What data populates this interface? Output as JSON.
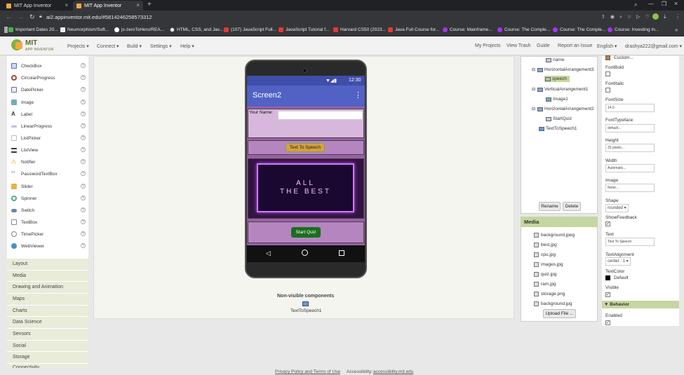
{
  "browser": {
    "tabs": [
      {
        "label": "MIT App Inventor"
      },
      {
        "label": "MIT App Inventor"
      }
    ],
    "url": "ai2.appinventor.mit.edu/#5814246258573312",
    "bookmarks": [
      "Important Dates 20...",
      "Neumorphism/Soft...",
      "js-zeroToHero/REA...",
      "HTML, CSS, and Jav...",
      "(107) JavaScript Full...",
      "JavaScript Tutorial f...",
      "Harvard CS50 (2023...",
      "Java Full Course for...",
      "Course: Mainframe...",
      "Course: The Comple...",
      "Course: The Comple...",
      "Course: Investing In..."
    ]
  },
  "app": {
    "logo_top": "MIT",
    "logo_bottom": "APP INVENTOR",
    "menus": [
      "Projects ▾",
      "Connect ▾",
      "Build ▾",
      "Settings ▾",
      "Help ▾"
    ],
    "right_links": [
      "My Projects",
      "View Trash",
      "Guide",
      "Report an Issue",
      "English ▾",
      "drashya222@gmail.com ▾"
    ]
  },
  "palette": {
    "items": [
      "CheckBox",
      "CircularProgress",
      "DatePicker",
      "Image",
      "Label",
      "LinearProgress",
      "ListPicker",
      "ListView",
      "Notifier",
      "PasswordTextBox",
      "Slider",
      "Spinner",
      "Switch",
      "TextBox",
      "TimePicker",
      "WebViewer"
    ],
    "categories": [
      "Layout",
      "Media",
      "Drawing and Animation",
      "Maps",
      "Charts",
      "Data Science",
      "Sensors",
      "Social",
      "Storage",
      "Connectivity"
    ]
  },
  "phone": {
    "time": "12:30",
    "screen_title": "Screen2",
    "name_label": "Your Name:",
    "speech_button": "Text To Speech",
    "banner_line1": "ALL",
    "banner_line2": "THE BEST",
    "start_button": "Start Quiz",
    "nonvisible_title": "Non-visible components",
    "nonvisible_item": "TextToSpeech1"
  },
  "tree": {
    "nodes": [
      "name",
      "HorizontalArrangement3",
      "speech",
      "VerticalArrangement1",
      "Image1",
      "HorizontalArrangement2",
      "StartQuiz",
      "TextToSpeech1"
    ],
    "rename": "Rename",
    "delete": "Delete"
  },
  "media": {
    "title": "Media",
    "files": [
      "background.jpeg",
      "best.jpg",
      "cpu.jpg",
      "images.jpg",
      "quiz.jpg",
      "ram.jpg",
      "storage.png",
      "background.jpg"
    ],
    "upload": "Upload File ..."
  },
  "properties": {
    "custom": "Custom...",
    "font_bold": "FontBold",
    "font_italic": "FontItalic",
    "font_size": "FontSize",
    "font_size_value": "14.0",
    "font_typeface": "FontTypeface",
    "font_typeface_value": "default...",
    "height": "Height",
    "height_value": "25 pixels...",
    "width": "Width",
    "width_value": "Automatic...",
    "image": "Image",
    "image_value": "None...",
    "shape": "Shape",
    "shape_value": "rounded ▾",
    "show_feedback": "ShowFeedback",
    "text": "Text",
    "text_value": "Text To Speech",
    "text_alignment": "TextAlignment",
    "text_alignment_value": "center : 1 ▾",
    "text_color": "TextColor",
    "text_color_value": "Default",
    "visible": "Visible",
    "behavior": "Behavior",
    "enabled": "Enabled"
  },
  "footer": {
    "privacy": "Privacy Policy and Terms of Use",
    "accessibility_label": "Accessibility:",
    "accessibility_link": "accessibility.mit.edu"
  }
}
